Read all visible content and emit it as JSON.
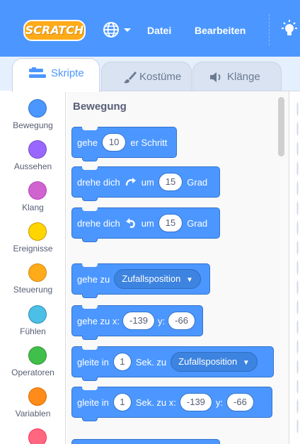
{
  "menubar": {
    "logo_text": "SCRATCH",
    "language_icon": "globe-icon",
    "file_label": "Datei",
    "edit_label": "Bearbeiten",
    "tutorial_icon": "lightbulb-icon",
    "background_color": "#4c97ff"
  },
  "tabs": [
    {
      "label": "Skripte",
      "icon": "code-icon",
      "active": true
    },
    {
      "label": "Kostüme",
      "icon": "paintbrush-icon",
      "active": false
    },
    {
      "label": "Klänge",
      "icon": "speaker-icon",
      "active": false
    }
  ],
  "categories": [
    {
      "name": "Bewegung",
      "color": "#4c97ff"
    },
    {
      "name": "Aussehen",
      "color": "#9966ff"
    },
    {
      "name": "Klang",
      "color": "#cf63cf"
    },
    {
      "name": "Ereignisse",
      "color": "#ffd500"
    },
    {
      "name": "Steuerung",
      "color": "#ffab19"
    },
    {
      "name": "Fühlen",
      "color": "#4cbfe6"
    },
    {
      "name": "Operatoren",
      "color": "#40bf4a"
    },
    {
      "name": "Variablen",
      "color": "#ff8c1a"
    },
    {
      "name": "",
      "color": "#ff6680"
    }
  ],
  "palette": {
    "section_title": "Bewegung",
    "blocks": {
      "move": {
        "text_before": "gehe",
        "value": "10",
        "text_after": "er Schritt"
      },
      "turn_right": {
        "text_before": "drehe dich",
        "text_mid": "um",
        "value": "15",
        "text_after": "Grad"
      },
      "turn_left": {
        "text_before": "drehe dich",
        "text_mid": "um",
        "value": "15",
        "text_after": "Grad"
      },
      "goto": {
        "text_before": "gehe zu",
        "dropdown": "Zufallsposition"
      },
      "goto_xy": {
        "text_before": "gehe zu x:",
        "x": "-139",
        "text_mid": "y:",
        "y": "-66"
      },
      "glide_to": {
        "text_before": "gleite in",
        "secs": "1",
        "text_mid": "Sek. zu",
        "dropdown": "Zufallsposition"
      },
      "glide_xy": {
        "text_before": "gleite in",
        "secs": "1",
        "text_mid": "Sek. zu x:",
        "x": "-139",
        "text_y": "y:",
        "y": "-66"
      }
    }
  }
}
